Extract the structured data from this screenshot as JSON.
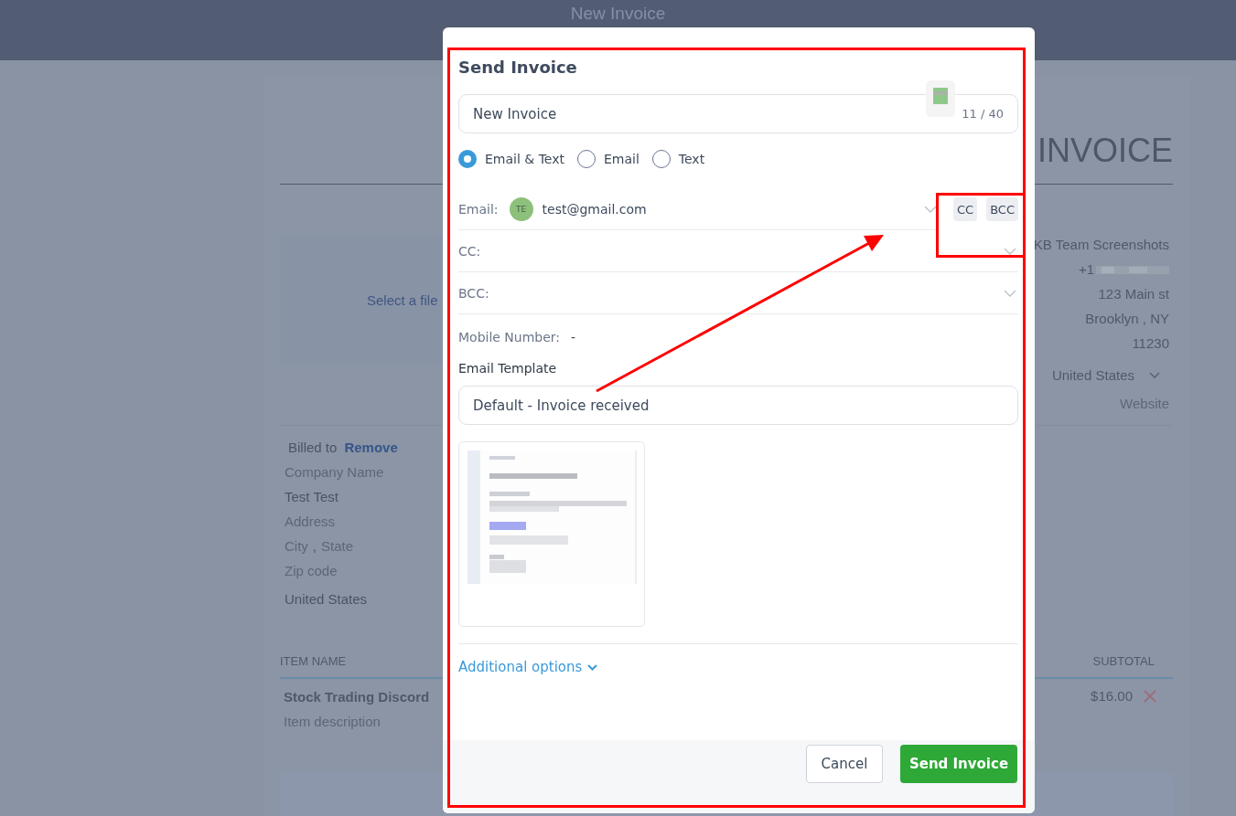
{
  "page": {
    "header_title": "New Invoice",
    "heading": "INVOICE",
    "logo_upload": "Select a file",
    "company": {
      "name": "KB Team Screenshots",
      "phone": "+1",
      "address": "123 Main st",
      "city_line": "Brooklyn ,  NY",
      "zip": "11230",
      "country": "United States",
      "website_placeholder": "Website"
    },
    "billed_to": {
      "label": "Billed to",
      "remove": "Remove",
      "company_placeholder": "Company Name",
      "name": "Test Test",
      "address_placeholder": "Address",
      "city_placeholder": "City",
      "separator": ",",
      "state_placeholder": "State",
      "zip_placeholder": "Zip code",
      "country": "United States"
    },
    "items": {
      "columns": [
        "ITEM NAME",
        "SUBTOTAL"
      ],
      "rows": [
        {
          "name": "Stock Trading Discord",
          "description_placeholder": "Item description",
          "subtotal": "$16.00"
        }
      ]
    }
  },
  "dialog": {
    "title": "Send Invoice",
    "subject": {
      "value": "New Invoice",
      "counter": "11 / 40"
    },
    "channels": [
      {
        "label": "Email & Text",
        "selected": true
      },
      {
        "label": "Email",
        "selected": false
      },
      {
        "label": "Text",
        "selected": false
      }
    ],
    "recipients": [
      {
        "label": "Email:",
        "chips": [
          {
            "initials": "TE",
            "address": "test@gmail.com"
          }
        ]
      },
      {
        "label": "CC:"
      },
      {
        "label": "BCC:"
      }
    ],
    "toggles": [
      "CC",
      "BCC"
    ],
    "mobile": {
      "label": "Mobile Number:",
      "value": "-"
    },
    "template": {
      "label": "Email Template",
      "value": "Default - Invoice received"
    },
    "additional_options": "Additional options",
    "buttons": {
      "cancel": "Cancel",
      "send": "Send Invoice"
    }
  }
}
